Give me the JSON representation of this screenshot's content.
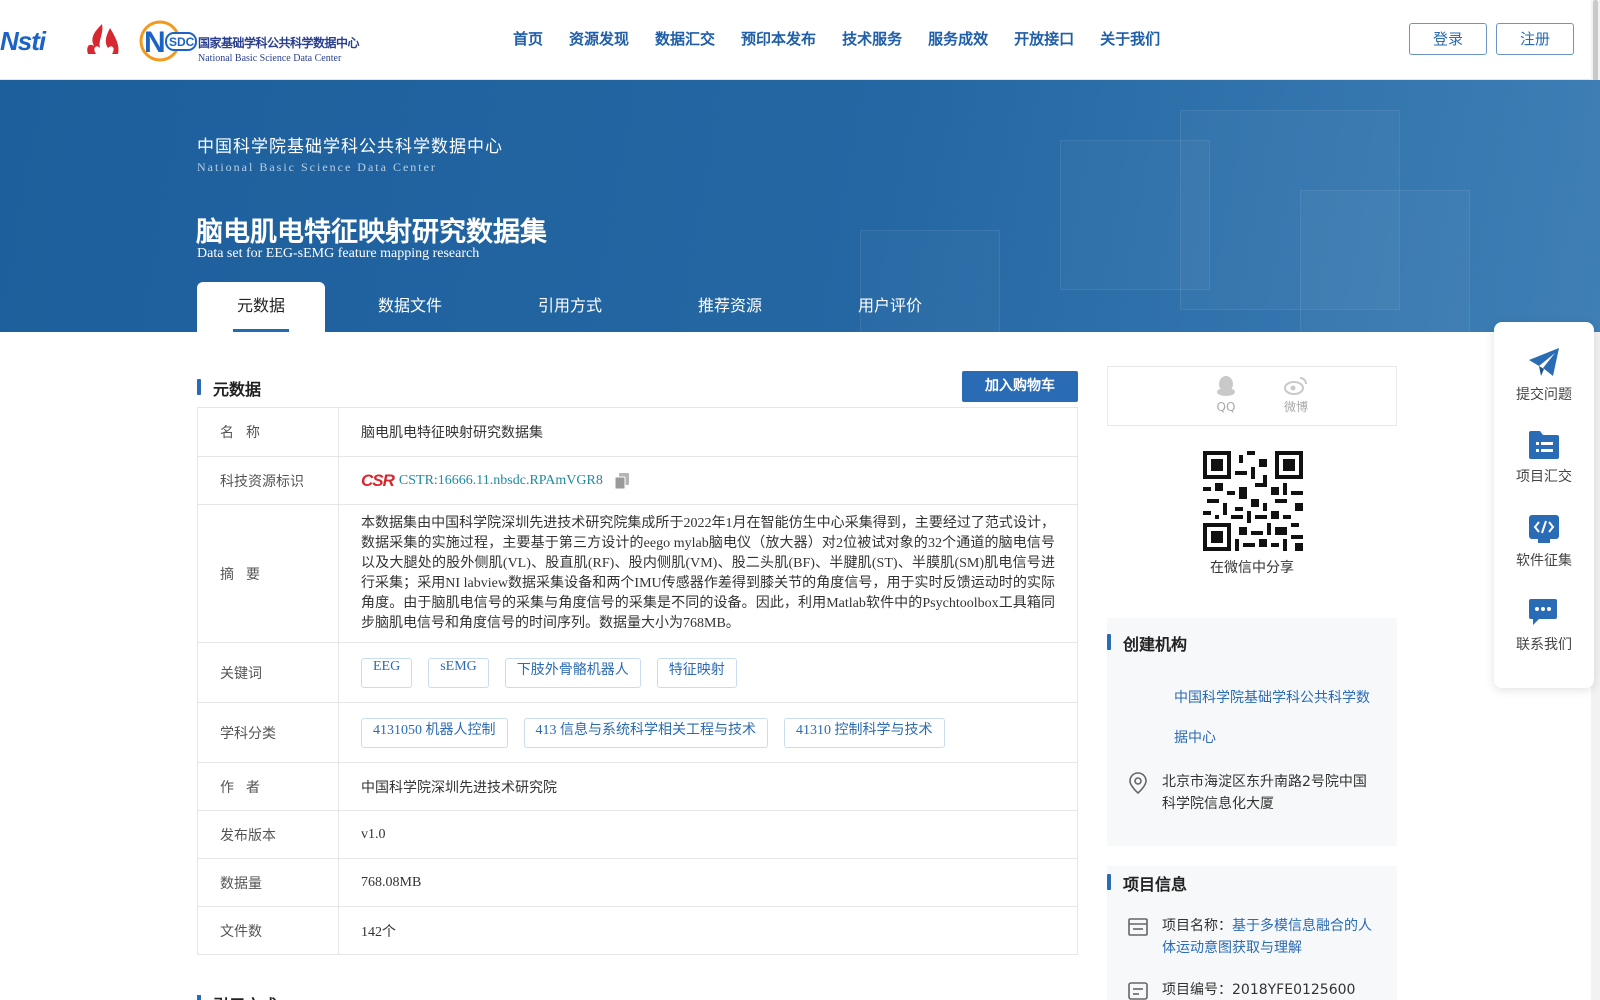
{
  "header": {
    "logo_cstr": "Nsti",
    "logo_nsdc_mark": "SDC",
    "logo_nsdc_cn": "国家基础学科公共科学数据中心",
    "logo_nsdc_en": "National Basic Science Data Center",
    "nav": [
      "首页",
      "资源发现",
      "数据汇交",
      "预印本发布",
      "技术服务",
      "服务成效",
      "开放接口",
      "关于我们"
    ],
    "login": "登录",
    "register": "注册"
  },
  "banner": {
    "center_cn": "中国科学院基础学科公共科学数据中心",
    "center_en": "National Basic Science Data Center",
    "title_cn": "脑电肌电特征映射研究数据集",
    "title_en": "Data set for EEG-sEMG feature mapping research",
    "tabs": [
      "元数据",
      "数据文件",
      "引用方式",
      "推荐资源",
      "用户评价"
    ],
    "active_tab": 0
  },
  "metadata": {
    "section_title": "元数据",
    "cart_button": "加入购物车",
    "rows": {
      "name": {
        "label": "名称",
        "value": "脑电肌电特征映射研究数据集"
      },
      "id": {
        "label": "科技资源标识",
        "logo": "CSR",
        "value": "CSTR:16666.11.nbsdc.RPAmVGR8"
      },
      "abstract": {
        "label": "摘要",
        "value": "本数据集由中国科学院深圳先进技术研究院集成所于2022年1月在智能仿生中心采集得到，主要经过了范式设计，数据采集的实施过程，主要基于第三方设计的eego mylab脑电仪（放大器）对2位被试对象的32个通道的脑电信号以及大腿处的股外侧肌(VL)、股直肌(RF)、股内侧肌(VM)、股二头肌(BF)、半腱肌(ST)、半膜肌(SM)肌电信号进行采集；采用NI labview数据采集设备和两个IMU传感器作差得到膝关节的角度信号，用于实时反馈运动时的实际角度。由于脑肌电信号的采集与角度信号的采集是不同的设备。因此，利用Matlab软件中的Psychtoolbox工具箱同步脑肌电信号和角度信号的时间序列。数据量大小为768MB。"
      },
      "keywords": {
        "label": "关键词",
        "values": [
          "EEG",
          "sEMG",
          "下肢外骨骼机器人",
          "特征映射"
        ]
      },
      "subjects": {
        "label": "学科分类",
        "values": [
          "4131050 机器人控制",
          "413 信息与系统科学相关工程与技术",
          "41310 控制科学与技术"
        ]
      },
      "author": {
        "label": "作者",
        "value": "中国科学院深圳先进技术研究院"
      },
      "version": {
        "label": "发布版本",
        "value": "v1.0"
      },
      "size": {
        "label": "数据量",
        "value": "768.08MB"
      },
      "files": {
        "label": "文件数",
        "value": "142个"
      }
    },
    "next_section_title": "引用方式"
  },
  "share": {
    "qq": "QQ",
    "weibo": "微博",
    "wechat_caption": "在微信中分享"
  },
  "organization": {
    "title": "创建机构",
    "name": "中国科学院基础学科公共科学数据中心",
    "address": "北京市海淀区东升南路2号院中国科学院信息化大厦"
  },
  "project": {
    "title": "项目信息",
    "name_label": "项目名称：",
    "name_value": "基于多模信息融合的人体运动意图获取与理解",
    "number_label": "项目编号：",
    "number_value": "2018YFE0125600"
  },
  "side_toolbar": [
    "提交问题",
    "项目汇交",
    "软件征集",
    "联系我们"
  ],
  "colors": {
    "brand_blue": "#2a6bb5",
    "banner_blue": "#1d5f9c",
    "cstr_red": "#d6282e"
  }
}
